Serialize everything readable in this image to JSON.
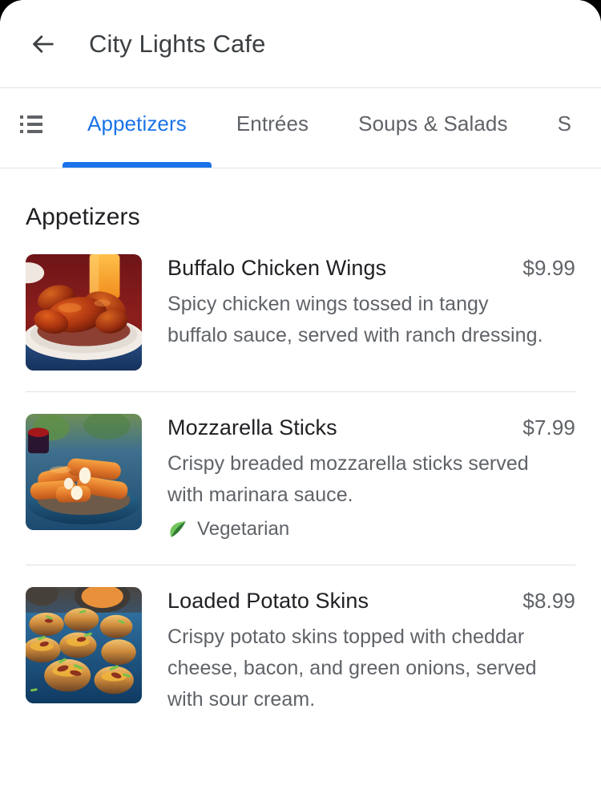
{
  "window": {
    "corner_radius": "30px",
    "background": "#ffffff"
  },
  "header": {
    "back_icon": "back-arrow-icon",
    "title": "City Lights Cafe",
    "title_color": "#3c4043"
  },
  "tab_bar": {
    "list_icon": "list-view-icon",
    "active_color": "#1a73e8",
    "inactive_color": "#5f6368",
    "active_index": 0,
    "tabs": [
      {
        "label": "Appetizers",
        "active": true
      },
      {
        "label": "Entrées",
        "active": false
      },
      {
        "label": "Soups & Salads",
        "active": false
      },
      {
        "label": "S",
        "active": false
      }
    ]
  },
  "menu": {
    "section_title": "Appetizers",
    "items": [
      {
        "name": "Buffalo Chicken Wings",
        "price": "$9.99",
        "description": "Spicy chicken wings tossed in tangy buffalo sauce, served with ranch dressing.",
        "thumbnail": "buffalo-chicken-wings-photo",
        "tags": []
      },
      {
        "name": "Mozzarella Sticks",
        "price": "$7.99",
        "description": "Crispy breaded mozzarella sticks served with marinara sauce.",
        "thumbnail": "mozzarella-sticks-photo",
        "tags": [
          {
            "icon": "leaf-icon",
            "label": "Vegetarian"
          }
        ]
      },
      {
        "name": "Loaded Potato Skins",
        "price": "$8.99",
        "description": "Crispy potato skins topped with cheddar cheese, bacon, and green onions, served with sour cream.",
        "thumbnail": "loaded-potato-skins-photo",
        "tags": []
      }
    ]
  }
}
